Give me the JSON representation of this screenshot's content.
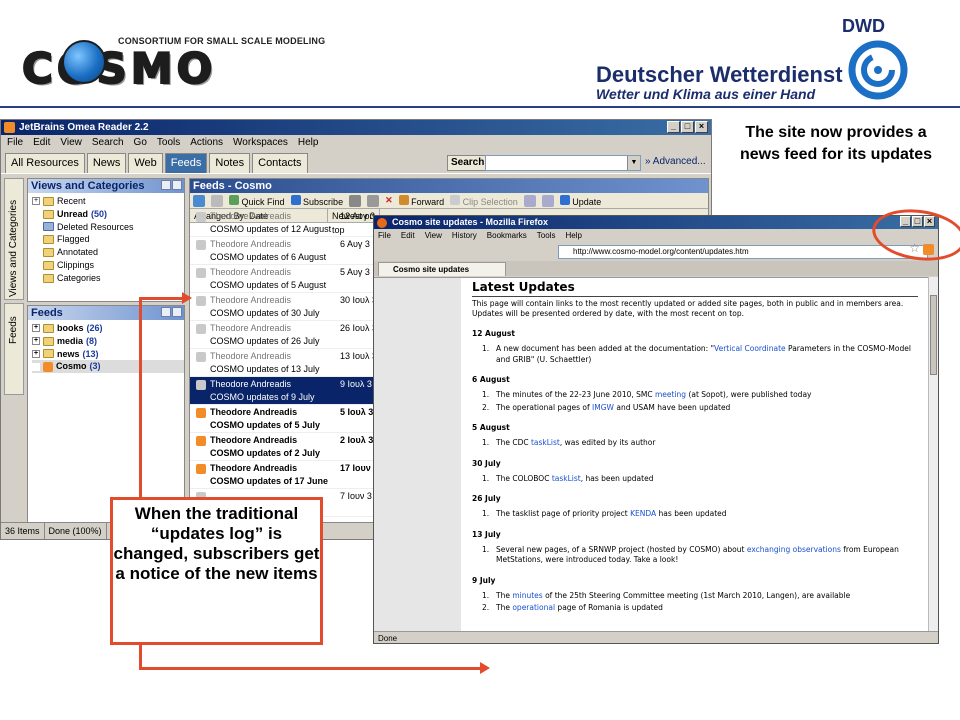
{
  "header": {
    "cosmo_letters": "COSMO",
    "cosmo_tagline": "CONSORTIUM FOR SMALL SCALE MODELING",
    "dwd_abbr": "DWD",
    "dwd_name": "Deutscher Wetterdienst",
    "dwd_slogan": "Wetter und Klima aus einer Hand",
    "rule_color": "#2b3f87"
  },
  "omea": {
    "title": "JetBrains Omea Reader 2.2",
    "menu": [
      "File",
      "Edit",
      "View",
      "Search",
      "Go",
      "Tools",
      "Actions",
      "Workspaces",
      "Help"
    ],
    "tabs": [
      "All Resources",
      "News",
      "Web",
      "Feeds",
      "Notes",
      "Contacts"
    ],
    "active_tab": "Feeds",
    "search_label": "Search",
    "search_value": "",
    "advanced_label": "Advanced...",
    "vertical_tabs": [
      "Views and Categories",
      "Feeds"
    ],
    "views_pane_title": "Views and Categories",
    "views": [
      {
        "label": "Recent",
        "count": "",
        "bold": false
      },
      {
        "label": "Unread",
        "count": "(50)",
        "bold": true
      },
      {
        "label": "Deleted Resources",
        "count": "",
        "bold": false
      },
      {
        "label": "Flagged",
        "count": "",
        "bold": false
      },
      {
        "label": "Annotated",
        "count": "",
        "bold": false
      },
      {
        "label": "Clippings",
        "count": "",
        "bold": false
      },
      {
        "label": "Categories",
        "count": "",
        "bold": false
      }
    ],
    "feeds_pane_title": "Feeds",
    "feed_tree": [
      {
        "label": "books",
        "count": "(26)"
      },
      {
        "label": "media",
        "count": "(8)"
      },
      {
        "label": "news",
        "count": "(13)"
      },
      {
        "label": "Cosmo",
        "count": "(3)"
      }
    ],
    "main_title": "Feeds - Cosmo",
    "toolbar": [
      "Quick Find",
      "Subscribe",
      "Forward",
      "Clip Selection",
      "Update"
    ],
    "columns": {
      "arranged": "Arranged By: Date",
      "sort": "Newest on top"
    },
    "items": [
      {
        "author": "Theodore Andreadis",
        "subject": "COSMO updates of 12 August",
        "date": "12 Αυγ 3",
        "state": "read"
      },
      {
        "author": "Theodore Andreadis",
        "subject": "COSMO updates of 6 August",
        "date": "6 Αυγ 3",
        "state": "read"
      },
      {
        "author": "Theodore Andreadis",
        "subject": "COSMO updates of 5 August",
        "date": "5 Αυγ 3",
        "state": "read"
      },
      {
        "author": "Theodore Andreadis",
        "subject": "COSMO updates of 30 July",
        "date": "30 Ιουλ 3",
        "state": "read"
      },
      {
        "author": "Theodore Andreadis",
        "subject": "COSMO updates of 26 July",
        "date": "26 Ιουλ 3",
        "state": "read"
      },
      {
        "author": "Theodore Andreadis",
        "subject": "COSMO updates of 13 July",
        "date": "13 Ιουλ 3",
        "state": "read"
      },
      {
        "author": "Theodore Andreadis",
        "subject": "COSMO updates of 9 July",
        "date": "9 Ιουλ 3",
        "state": "selected"
      },
      {
        "author": "Theodore Andreadis",
        "subject": "COSMO updates of 5 July",
        "date": "5 Ιουλ 3",
        "state": "unread"
      },
      {
        "author": "Theodore Andreadis",
        "subject": "COSMO updates of 2 July",
        "date": "2 Ιουλ 3",
        "state": "unread"
      },
      {
        "author": "Theodore Andreadis",
        "subject": "COSMO updates of 17 June",
        "date": "17 Ιουν 3",
        "state": "unread"
      },
      {
        "author": "",
        "subject": "",
        "date": "7 Ιουν 3",
        "state": "read"
      }
    ],
    "status": [
      "36 Items",
      "Done (100%)"
    ]
  },
  "firefox": {
    "title": "Cosmo site updates - Mozilla Firefox",
    "menu": [
      "File",
      "Edit",
      "View",
      "History",
      "Bookmarks",
      "Tools",
      "Help"
    ],
    "url": "http://www.cosmo-model.org/content/updates.htm",
    "tab_label": "Cosmo site updates",
    "heading": "Latest Updates",
    "intro": "This page will contain links to the most recently updated or added site pages, both in public and in members area. Updates will be presented ordered by date, with the most recent on top.",
    "days": [
      {
        "date": "12 August",
        "items": [
          {
            "n": "1.",
            "pre": "A new document has been added at the documentation: \"",
            "link": "Vertical Coordinate",
            "post": " Parameters in the COSMO-Model and GRIB\" (U. Schaettler)"
          }
        ]
      },
      {
        "date": "6 August",
        "items": [
          {
            "n": "1.",
            "pre": "The minutes of the 22-23 June 2010, SMC ",
            "link": "meeting",
            "post": " (at Sopot), were published today"
          },
          {
            "n": "2.",
            "pre": "The operational pages of ",
            "link": "IMGW",
            "post": " and USAM have been updated"
          }
        ]
      },
      {
        "date": "5 August",
        "items": [
          {
            "n": "1.",
            "pre": "The CDC ",
            "link": "taskList",
            "post": ", was edited by its author"
          }
        ]
      },
      {
        "date": "30 July",
        "items": [
          {
            "n": "1.",
            "pre": "The COLOBOC ",
            "link": "taskList",
            "post": ", has been updated"
          }
        ]
      },
      {
        "date": "26 July",
        "items": [
          {
            "n": "1.",
            "pre": "The tasklist page of priority project ",
            "link": "KENDA",
            "post": " has been updated"
          }
        ]
      },
      {
        "date": "13 July",
        "items": [
          {
            "n": "1.",
            "pre": "Several new pages, of a SRNWP project (hosted by COSMO) about ",
            "link": "exchanging observations",
            "post": " from European MetStations, were introduced today. Take a look!"
          }
        ]
      },
      {
        "date": "9 July",
        "items": [
          {
            "n": "1.",
            "pre": "The ",
            "link": "minutes",
            "post": " of the 25th Steering Committee meeting (1st March 2010, Langen), are available"
          },
          {
            "n": "2.",
            "pre": "The ",
            "link": "operational",
            "post": " page of Romania is updated"
          }
        ]
      }
    ],
    "status": "Done"
  },
  "annotations": {
    "top_right": "The site now provides a news feed for its updates",
    "box": "When the traditional “updates log” is changed, subscribers get a notice of the new items",
    "accent_color": "#e24c2c"
  }
}
